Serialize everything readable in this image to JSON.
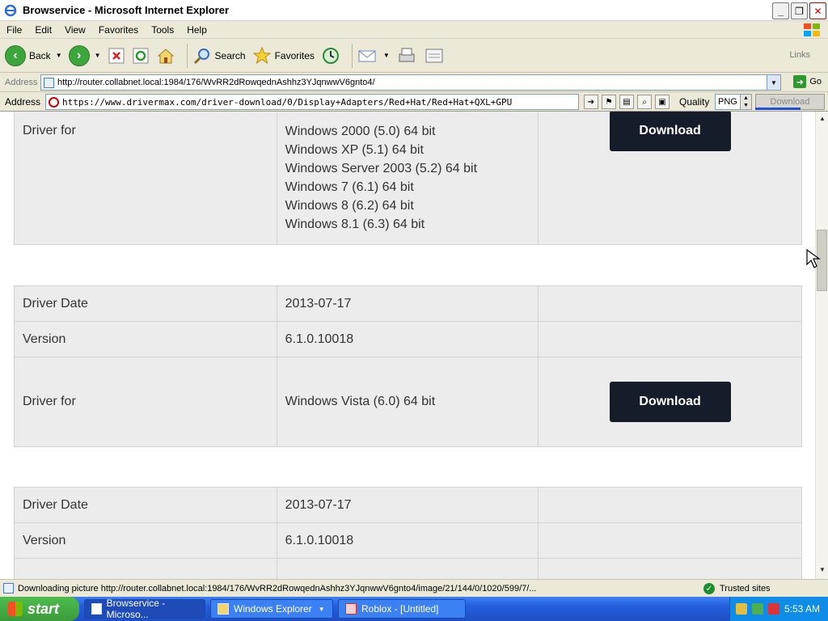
{
  "window": {
    "title": "Browservice - Microsoft Internet Explorer",
    "buttons": {
      "minimize": "_",
      "maximize": "❐",
      "close": "✕"
    }
  },
  "menu": [
    "File",
    "Edit",
    "View",
    "Favorites",
    "Tools",
    "Help"
  ],
  "toolbar": {
    "back": "Back",
    "search": "Search",
    "favorites": "Favorites",
    "links": "Links"
  },
  "address": {
    "label": "Address",
    "url": "http://router.collabnet.local:1984/176/WvRR2dRowqednAshhz3YJqnwwV6gnto4/",
    "go": "Go"
  },
  "browservice_bar": {
    "label": "Address",
    "url": "https://www.drivermax.com/driver-download/0/Display+Adapters/Red+Hat/Red+Hat+QXL+GPU",
    "quality_label": "Quality",
    "quality_value": "PNG",
    "download_label": "Download"
  },
  "content": {
    "block1": {
      "label": "Driver for",
      "os": [
        "Windows 2000 (5.0) 64 bit",
        "Windows XP (5.1) 64 bit",
        "Windows Server 2003 (5.2) 64 bit",
        "Windows 7 (6.1) 64 bit",
        "Windows 8 (6.2) 64 bit",
        "Windows 8.1 (6.3) 64 bit"
      ],
      "button": "Download"
    },
    "block2": {
      "date_label": "Driver Date",
      "date": "2013-07-17",
      "version_label": "Version",
      "version": "6.1.0.10018",
      "driver_for_label": "Driver for",
      "os": "Windows Vista (6.0) 64 bit",
      "button": "Download"
    },
    "block3": {
      "date_label": "Driver Date",
      "date": "2013-07-17",
      "version_label": "Version",
      "version": "6.1.0.10018"
    }
  },
  "status": {
    "text": "Downloading picture http://router.collabnet.local:1984/176/WvRR2dRowqednAshhz3YJqnwwV6gnto4/image/21/144/0/1020/599/7/...",
    "zone": "Trusted sites"
  },
  "taskbar": {
    "start": "start",
    "tasks": [
      "Browservice - Microso...",
      "Windows Explorer",
      "Roblox - [Untitled]"
    ],
    "clock": "5:53 AM"
  }
}
